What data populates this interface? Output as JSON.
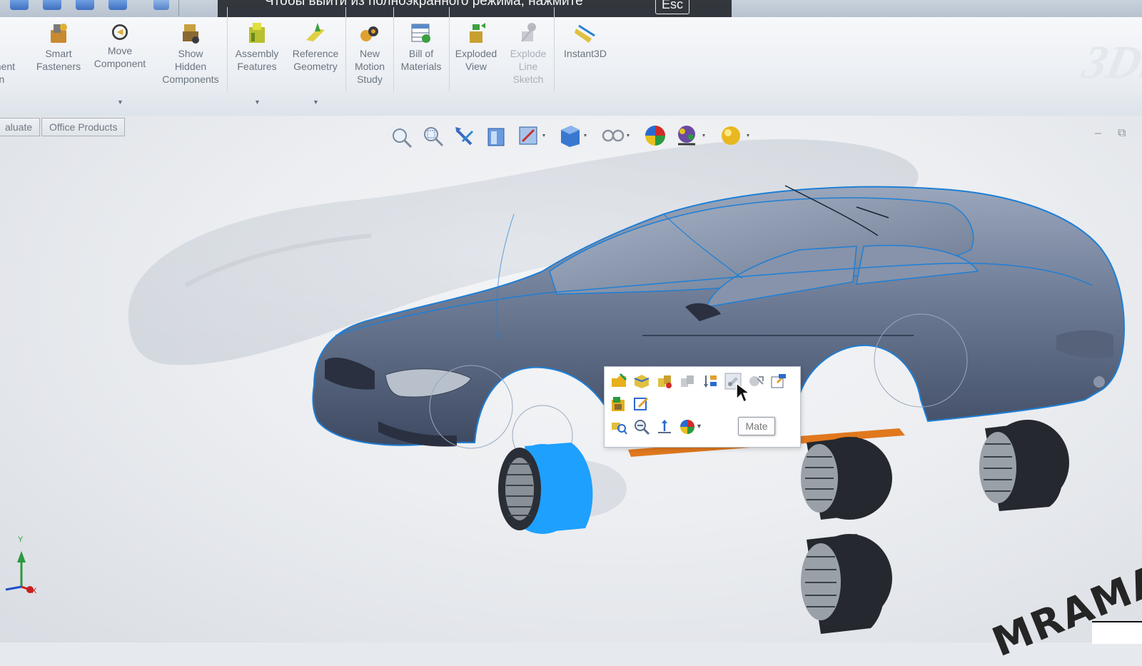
{
  "fullscreen_banner": {
    "message": "Чтобы выйти из полноэкранного режима, нажмите",
    "key": "Esc"
  },
  "ribbon": {
    "buttons": [
      {
        "id": "pattern",
        "label": "ar\nonent\nern"
      },
      {
        "id": "smart_fasteners",
        "label": "Smart\nFasteners"
      },
      {
        "id": "move_component",
        "label": "Move\nComponent"
      },
      {
        "id": "show_hidden",
        "label": "Show\nHidden\nComponents"
      },
      {
        "id": "assembly_features",
        "label": "Assembly\nFeatures"
      },
      {
        "id": "reference_geometry",
        "label": "Reference\nGeometry"
      },
      {
        "id": "new_motion",
        "label": "New\nMotion\nStudy"
      },
      {
        "id": "bom",
        "label": "Bill of\nMaterials"
      },
      {
        "id": "exploded_view",
        "label": "Exploded\nView"
      },
      {
        "id": "explode_line",
        "label": "Explode\nLine\nSketch"
      },
      {
        "id": "instant3d",
        "label": "Instant3D"
      }
    ]
  },
  "tabs": [
    {
      "label": "aluate"
    },
    {
      "label": "Office Products"
    }
  ],
  "heads_up_toolbar": {
    "icons": [
      "zoom-to-fit-icon",
      "zoom-to-area-icon",
      "previous-view-icon",
      "section-view-icon",
      "view-orientation-icon",
      "display-style-icon",
      "hide-show-icon",
      "edit-appearance-icon",
      "apply-scene-icon",
      "view-settings-icon"
    ]
  },
  "context_toolbar": {
    "tooltip": "Mate"
  },
  "triad": {
    "y_label": "Y",
    "x_label": "X"
  },
  "watermark": "MRAMAR*D",
  "colors": {
    "selection_blue": "#1ea0ff",
    "car_body": "#5f6f88",
    "edge_highlight": "#1e7fd6",
    "floor_orange": "#e0781e"
  }
}
